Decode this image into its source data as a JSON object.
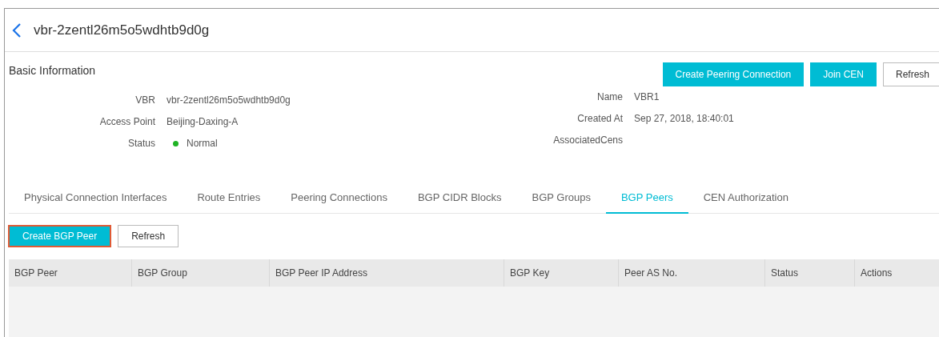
{
  "header": {
    "title": "vbr-2zentl26m5o5wdhtb9d0g"
  },
  "basic_information": {
    "title": "Basic Information",
    "buttons": [
      {
        "label": "Create Peering Connection",
        "kind": "primary"
      },
      {
        "label": "Join CEN",
        "kind": "primary"
      },
      {
        "label": "Refresh",
        "kind": "default"
      }
    ],
    "left_fields": [
      {
        "label": "VBR",
        "value": "vbr-2zentl26m5o5wdhtb9d0g"
      },
      {
        "label": "Access Point",
        "value": "Beijing-Daxing-A"
      },
      {
        "label": "Status",
        "value": "Normal",
        "color": "#1fb324"
      }
    ],
    "right_fields": [
      {
        "label": "Name",
        "value": "VBR1"
      },
      {
        "label": "Created At",
        "value": "Sep 27, 2018, 18:40:01"
      },
      {
        "label": "AssociatedCens"
      }
    ]
  },
  "tabs": [
    {
      "label": "Physical Connection Interfaces",
      "selected": false
    },
    {
      "label": "Route Entries",
      "selected": false
    },
    {
      "label": "Peering Connections",
      "selected": false
    },
    {
      "label": "BGP CIDR Blocks",
      "selected": false
    },
    {
      "label": "BGP Groups",
      "selected": false
    },
    {
      "label": "BGP Peers",
      "selected": true
    },
    {
      "label": "CEN Authorization",
      "selected": false
    }
  ],
  "toolbar": [
    {
      "label": "Create BGP Peer",
      "kind": "primary",
      "highlighted": true
    },
    {
      "label": "Refresh",
      "kind": "default",
      "highlighted": false
    }
  ],
  "table": {
    "columns": [
      "BGP Peer",
      "BGP Group",
      "BGP Peer IP Address",
      "BGP Key",
      "Peer AS No.",
      "Status",
      "Actions"
    ]
  }
}
